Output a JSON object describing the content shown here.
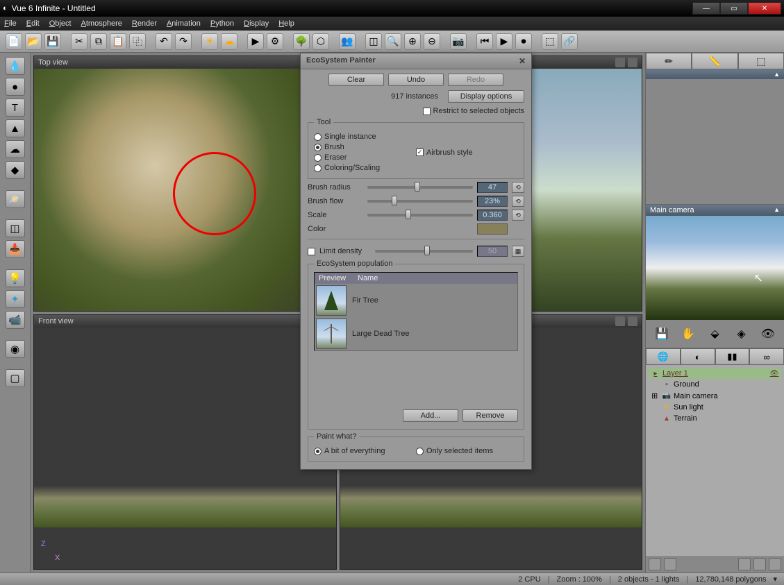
{
  "window": {
    "title": "Vue 6 Infinite - Untitled"
  },
  "menu": {
    "file": "File",
    "edit": "Edit",
    "object": "Object",
    "atmosphere": "Atmosphere",
    "render": "Render",
    "animation": "Animation",
    "python": "Python",
    "display": "Display",
    "help": "Help"
  },
  "viewports": {
    "top": "Top view",
    "front": "Front view",
    "main_camera_hdr": "Main camera"
  },
  "dialog": {
    "title": "EcoSystem Painter",
    "clear": "Clear",
    "undo": "Undo",
    "redo": "Redo",
    "instances": "917 instances",
    "display_options": "Display options",
    "restrict": "Restrict to selected objects",
    "tool_legend": "Tool",
    "single": "Single instance",
    "brush": "Brush",
    "eraser": "Eraser",
    "coloring": "Coloring/Scaling",
    "airbrush": "Airbrush style",
    "brush_radius": "Brush radius",
    "brush_radius_val": "47",
    "brush_flow": "Brush flow",
    "brush_flow_val": "23%",
    "scale": "Scale",
    "scale_val": "0.360",
    "color": "Color",
    "limit_density": "Limit density",
    "limit_density_val": "50",
    "population_legend": "EcoSystem population",
    "col_preview": "Preview",
    "col_name": "Name",
    "fir": "Fir Tree",
    "dead": "Large Dead Tree",
    "add": "Add...",
    "remove": "Remove",
    "paint_legend": "Paint what?",
    "bit_everything": "A bit of everything",
    "only_selected": "Only selected items"
  },
  "layers": {
    "layer1": "Layer 1",
    "ground": "Ground",
    "main_camera": "Main camera",
    "sun": "Sun light",
    "terrain": "Terrain"
  },
  "status": {
    "cpu": "2 CPU",
    "zoom": "Zoom : 100%",
    "objects": "2 objects - 1 lights",
    "polys": "12,780,148 polygons"
  },
  "axis": {
    "z": "Z",
    "x": "X"
  }
}
